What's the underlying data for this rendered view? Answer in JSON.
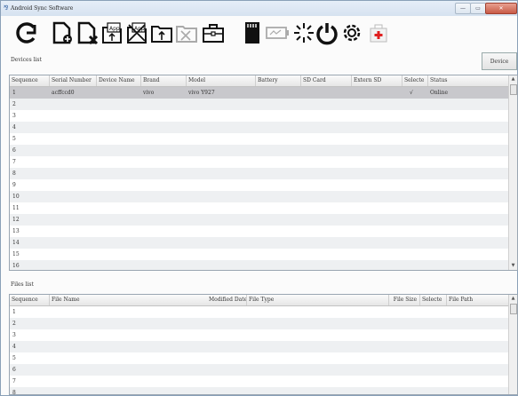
{
  "window": {
    "title": "Android Sync Software",
    "app_icon": "android-sync-icon",
    "min": "—",
    "max": "▭",
    "close": "✕"
  },
  "toolbar": {
    "buttons": [
      {
        "name": "refresh-icon"
      },
      {
        "name": "add-file-icon"
      },
      {
        "name": "delete-file-icon"
      },
      {
        "name": "install-app-icon",
        "label": "App"
      },
      {
        "name": "uninstall-app-icon",
        "label": "App"
      },
      {
        "name": "upload-folder-icon"
      },
      {
        "name": "export-folder-icon"
      },
      {
        "name": "toolbox-icon"
      },
      {
        "name": "sd-card-icon"
      },
      {
        "name": "battery-icon"
      },
      {
        "name": "loading-icon"
      },
      {
        "name": "power-icon"
      },
      {
        "name": "settings-icon"
      },
      {
        "name": "first-aid-icon"
      }
    ]
  },
  "devices": {
    "label": "Devices list",
    "device_name_button": "Device Name",
    "columns": [
      "Sequence",
      "Serial Number",
      "Device Name",
      "Brand",
      "Model",
      "Battery",
      "SD Card",
      "Extern SD",
      "Selecte",
      "Status"
    ],
    "rows": [
      {
        "seq": "1",
        "serial": "acffccd0",
        "device": "",
        "brand": "vivo",
        "model": "vivo Y927",
        "battery": "",
        "sd": "",
        "ext": "",
        "selected": "√",
        "status": "Online"
      },
      {
        "seq": "2"
      },
      {
        "seq": "3"
      },
      {
        "seq": "4"
      },
      {
        "seq": "5"
      },
      {
        "seq": "6"
      },
      {
        "seq": "7"
      },
      {
        "seq": "8"
      },
      {
        "seq": "9"
      },
      {
        "seq": "10"
      },
      {
        "seq": "11"
      },
      {
        "seq": "12"
      },
      {
        "seq": "13"
      },
      {
        "seq": "14"
      },
      {
        "seq": "15"
      },
      {
        "seq": "16"
      }
    ]
  },
  "files": {
    "label": "Files list",
    "columns": [
      "Sequence",
      "File Name",
      "Modified Date",
      "File Type",
      "File Size",
      "Selecte",
      "File Path"
    ],
    "rows": [
      {
        "seq": "1"
      },
      {
        "seq": "2"
      },
      {
        "seq": "3"
      },
      {
        "seq": "4"
      },
      {
        "seq": "5"
      },
      {
        "seq": "6"
      },
      {
        "seq": "7"
      },
      {
        "seq": "8"
      }
    ]
  }
}
